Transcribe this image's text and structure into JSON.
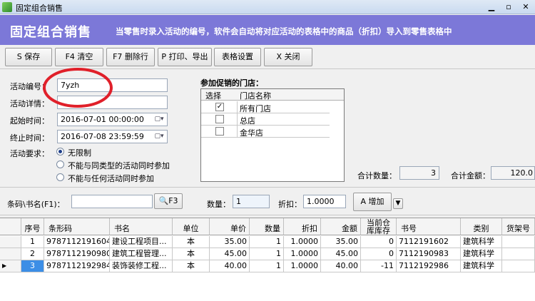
{
  "window": {
    "title": "固定组合销售"
  },
  "banner": {
    "title": "固定组合销售",
    "description": "当零售时录入活动的编号，软件会自动将对应活动的表格中的商品（折扣）导入到零售表格中"
  },
  "toolbar": {
    "save": "S 保存",
    "clear": "F4 清空",
    "delete_row": "F7 删除行",
    "print": "P 打印、导出",
    "table_settings": "表格设置",
    "close": "X 关闭"
  },
  "form": {
    "activity_code_label": "活动编号：",
    "activity_code_value": "7yzh",
    "activity_detail_label": "活动详情：",
    "activity_detail_value": "",
    "start_time_label": "起始时间：",
    "start_time_value": "2016-07-01 00:00:00",
    "end_time_label": "终止时间：",
    "end_time_value": "2016-07-08 23:59:59",
    "requirement_label": "活动要求：",
    "options": [
      {
        "label": "无限制",
        "selected": true
      },
      {
        "label": "不能与同类型的活动同时参加",
        "selected": false
      },
      {
        "label": "不能与任何活动同时参加",
        "selected": false
      }
    ]
  },
  "stores": {
    "label": "参加促销的门店：",
    "col_select": "选择",
    "col_name": "门店名称",
    "rows": [
      {
        "name": "所有门店",
        "checked": true
      },
      {
        "name": "总店",
        "checked": false
      },
      {
        "name": "金华店",
        "checked": false
      }
    ]
  },
  "totals": {
    "qty_label": "合计数量：",
    "qty_value": "3",
    "amount_label": "合计金额：",
    "amount_value": "120.0"
  },
  "scan": {
    "barcode_label": "条码\\书名(F1)：",
    "barcode_value": "",
    "search_button": "F3",
    "qty_label": "数量：",
    "qty_value": "1",
    "discount_label": "折扣：",
    "discount_value": "1.0000",
    "add_button": "A 增加"
  },
  "grid": {
    "headers": [
      "序号",
      "条形码",
      "书名",
      "单位",
      "单价",
      "数量",
      "折扣",
      "金额",
      "当前仓库库存",
      "书号",
      "类别",
      "货架号"
    ],
    "rows": [
      [
        "1",
        "9787112191604",
        "建设工程项目...",
        "本",
        "35.00",
        "1",
        "1.0000",
        "35.00",
        "0",
        "7112191602",
        "建筑科学",
        ""
      ],
      [
        "2",
        "9787112190980",
        "建筑工程管理...",
        "本",
        "45.00",
        "1",
        "1.0000",
        "45.00",
        "0",
        "7112190983",
        "建筑科学",
        ""
      ],
      [
        "3",
        "9787112192984",
        "装饰装修工程...",
        "本",
        "40.00",
        "1",
        "1.0000",
        "40.00",
        "-11",
        "7112192986",
        "建筑科学",
        ""
      ]
    ]
  },
  "colors": {
    "banner": "#7c78d8",
    "annotation": "#e0202a",
    "selected_row": "#3c8ee6"
  }
}
